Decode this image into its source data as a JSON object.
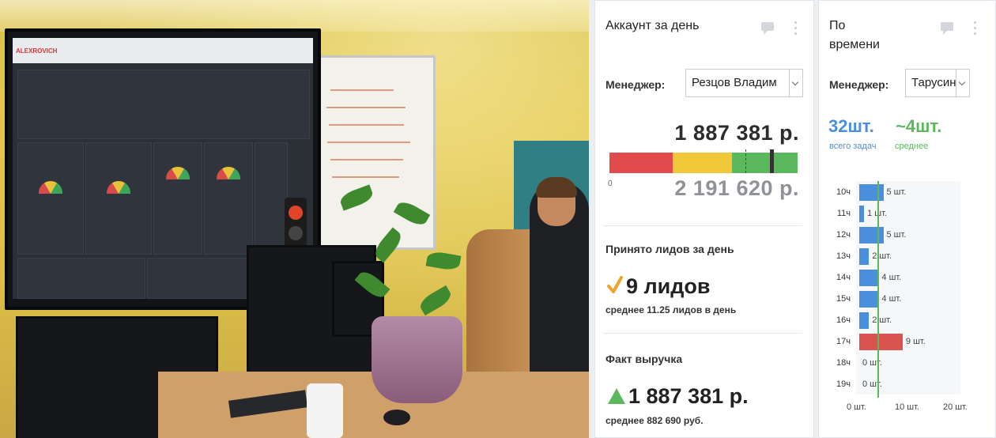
{
  "photo": {
    "tv_brand": "ALEXROVICH"
  },
  "colors": {
    "red": "#e24b4b",
    "yellow": "#f0c93a",
    "green": "#5cb85c",
    "blue": "#4a8fdc",
    "highlight_bar": "#d9534f",
    "avg_line": "#5cb85c"
  },
  "account_card": {
    "title": "Аккаунт за день",
    "manager_label": "Менеджер:",
    "manager_value": "Резцов Владим",
    "fact_amount": "1 887 381 р.",
    "gauge_zero": "0",
    "plan_amount": "2 191 620 р.",
    "progress_fraction": 0.861,
    "leads_title": "Принято лидов за день",
    "leads_value": "9 лидов",
    "leads_avg": "среднее 11.25 лидов в день",
    "revenue_title": "Факт выручка",
    "revenue_value": "1 887 381 р.",
    "revenue_avg": "среднее 882 690 руб."
  },
  "time_card": {
    "title": "По времени",
    "manager_label": "Менеджер:",
    "manager_value": "Тарусин",
    "total_value": "32шт.",
    "total_caption": "всего задач",
    "avg_value": "~4шт.",
    "avg_caption": "среднее"
  },
  "chart_data": {
    "type": "bar",
    "orientation": "horizontal",
    "categories": [
      "10ч",
      "11ч",
      "12ч",
      "13ч",
      "14ч",
      "15ч",
      "16ч",
      "17ч",
      "18ч",
      "19ч"
    ],
    "values": [
      5,
      1,
      5,
      2,
      4,
      4,
      2,
      9,
      0,
      0
    ],
    "value_labels": [
      "5 шт.",
      "1 шт.",
      "5 шт.",
      "2 шт.",
      "4 шт.",
      "4 шт.",
      "2 шт.",
      "9 шт.",
      "0 шт.",
      "0 шт."
    ],
    "highlight_index": 7,
    "average": 4,
    "xlim": [
      0,
      20
    ],
    "xticks": [
      "0 шт.",
      "10 шт.",
      "20 шт."
    ]
  }
}
